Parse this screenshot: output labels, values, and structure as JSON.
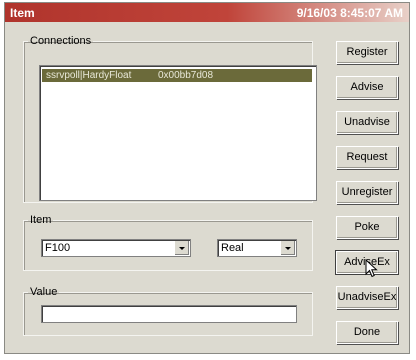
{
  "window": {
    "title": "Item",
    "clock": "9/16/03 8:45:07 AM"
  },
  "connections": {
    "label": "Connections",
    "rows": [
      {
        "name": "ssrvpoll|HardyFloat",
        "handle": "0x00bb7d08"
      }
    ]
  },
  "item": {
    "label": "Item",
    "name_value": "F100",
    "type_value": "Real"
  },
  "value": {
    "label": "Value",
    "text": ""
  },
  "buttons": {
    "register": "Register",
    "advise": "Advise",
    "unadvise": "Unadvise",
    "request": "Request",
    "unregister": "Unregister",
    "poke": "Poke",
    "advise_ex": "AdviseEx",
    "unadvise_ex": "UnadviseEx",
    "done": "Done"
  },
  "icons": {
    "cursor": "mouse-pointer-icon",
    "dropdown": "chevron-down-icon"
  }
}
